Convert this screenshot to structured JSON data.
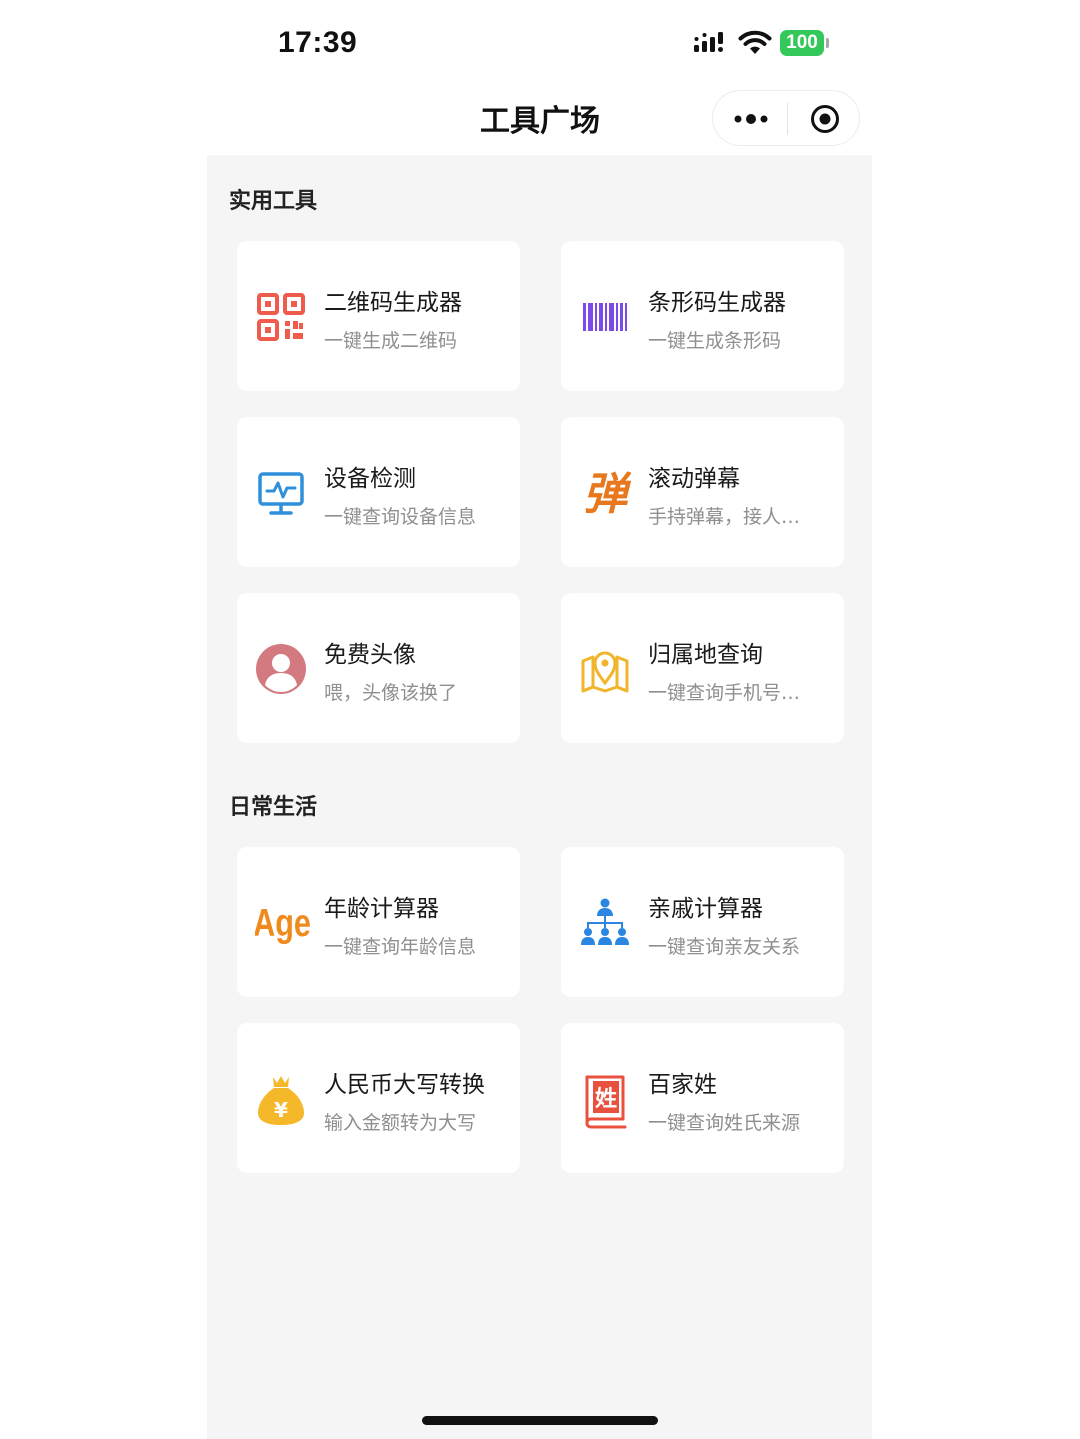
{
  "status_bar": {
    "time": "17:39",
    "battery": "100",
    "battery_color": "#34c759"
  },
  "nav": {
    "title": "工具广场",
    "more_icon": "more-dots-icon",
    "close_icon": "target-circle-icon"
  },
  "sections": [
    {
      "title": "实用工具",
      "cards": [
        {
          "title": "二维码生成器",
          "subtitle": "一键生成二维码",
          "icon": "qr-code-icon",
          "icon_color": "#ef5b4c"
        },
        {
          "title": "条形码生成器",
          "subtitle": "一键生成条形码",
          "icon": "barcode-icon",
          "icon_color": "#7b4ae8"
        },
        {
          "title": "设备检测",
          "subtitle": "一键查询设备信息",
          "icon": "monitor-pulse-icon",
          "icon_color": "#2e8fdb"
        },
        {
          "title": "滚动弹幕",
          "subtitle": "手持弹幕，接人…",
          "icon": "danmaku-char-icon",
          "icon_text": "弹",
          "icon_color": "#e8781e"
        },
        {
          "title": "免费头像",
          "subtitle": "喂，头像该换了",
          "icon": "avatar-icon",
          "icon_color": "#d37a80"
        },
        {
          "title": "归属地查询",
          "subtitle": "一键查询手机号…",
          "icon": "map-pin-icon",
          "icon_color": "#f0b52a"
        }
      ]
    },
    {
      "title": "日常生活",
      "cards": [
        {
          "title": "年龄计算器",
          "subtitle": "一键查询年龄信息",
          "icon": "age-text-icon",
          "icon_text": "Age",
          "icon_color": "#f08a1c"
        },
        {
          "title": "亲戚计算器",
          "subtitle": "一键查询亲友关系",
          "icon": "org-chart-icon",
          "icon_color": "#2a86e0"
        },
        {
          "title": "人民币大写转换",
          "subtitle": "输入金额转为大写",
          "icon": "money-bag-icon",
          "icon_text": "¥",
          "icon_color": "#f5b82a"
        },
        {
          "title": "百家姓",
          "subtitle": "一键查询姓氏来源",
          "icon": "surname-book-icon",
          "icon_text": "姓",
          "icon_color": "#e9503d"
        }
      ]
    }
  ]
}
